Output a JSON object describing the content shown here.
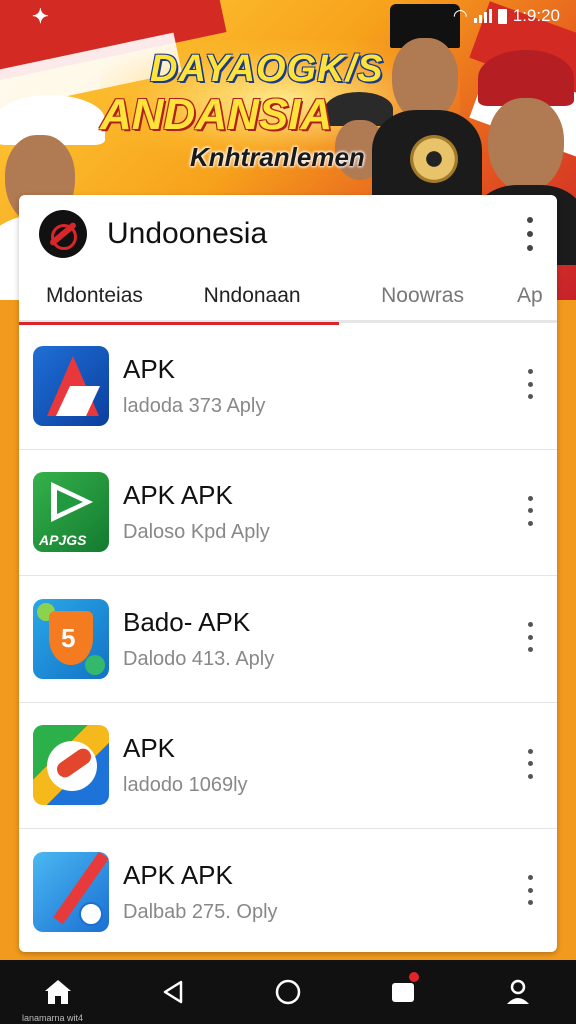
{
  "status_bar": {
    "time": "1:9:20"
  },
  "banner": {
    "line1": "DAYAOGK/S",
    "line2": "ANDANSIA",
    "line3": "Knhtranlemen"
  },
  "app": {
    "title": "Undoonesia"
  },
  "tabs": [
    {
      "label": "Mdonteias",
      "active": true
    },
    {
      "label": "Nndonaan",
      "active": true
    },
    {
      "label": "Noowras",
      "active": false
    },
    {
      "label": "Ap",
      "active": false
    }
  ],
  "apps": [
    {
      "name": "APK",
      "meta": "ladoda 373 Aply",
      "icon": "red-a-logo-icon"
    },
    {
      "name": "APK APK",
      "meta": "Daloso Kpd Aply",
      "icon": "green-play-icon",
      "icon_label": "APJGS"
    },
    {
      "name": "Bado- APK",
      "meta": "Dalodo 413. Aply",
      "icon": "orange-shield-icon"
    },
    {
      "name": "APK",
      "meta": "ladodo 1069ly",
      "icon": "compass-icon"
    },
    {
      "name": "APK APK",
      "meta": "Dalbab 275. Oply",
      "icon": "blue-slash-icon"
    }
  ],
  "navbar": {
    "caption": "lanamarna wit4"
  },
  "colors": {
    "accent": "#d8262b",
    "banner_yellow": "#ffe23a",
    "nav_bg": "#111111"
  }
}
